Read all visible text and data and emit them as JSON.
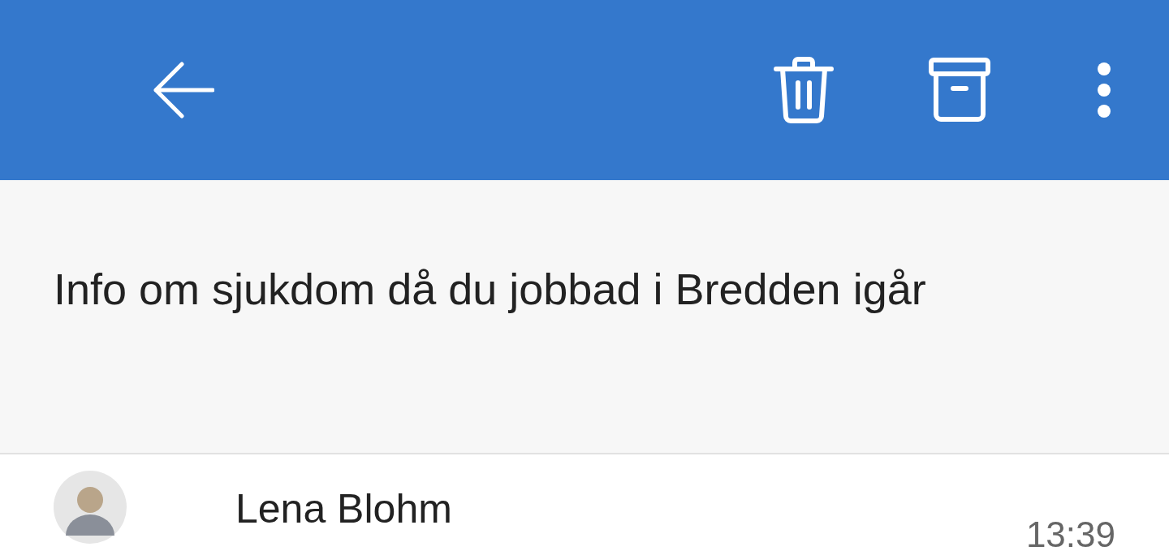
{
  "subject": "Info om sjukdom då du jobbad i Bredden igår",
  "message": {
    "sender": "Lena Blohm",
    "time": "13:39"
  }
}
